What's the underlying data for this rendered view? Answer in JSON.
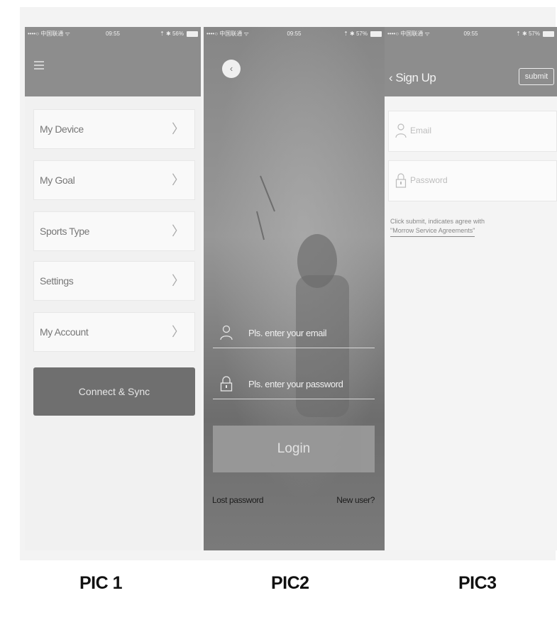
{
  "pic1": {
    "statusbar": {
      "left": "••••○ 中国联通 ᯤ",
      "time": "09:55",
      "right": "⇡ ✱ 56%"
    },
    "menu_items": [
      {
        "label": "My Device"
      },
      {
        "label": "My Goal"
      },
      {
        "label": "Sports Type"
      },
      {
        "label": "Settings"
      },
      {
        "label": "My Account"
      }
    ],
    "sync_button": "Connect & Sync"
  },
  "pic2": {
    "statusbar": {
      "left": "••••○ 中国联通 ᯤ",
      "time": "09:55",
      "right": "⇡ ✱ 57%"
    },
    "email_placeholder": "Pls. enter your email",
    "password_placeholder": "Pls. enter your password",
    "login_button": "Login",
    "forgot_link": "Lost password",
    "new_user_link": "New user?"
  },
  "pic3": {
    "statusbar": {
      "left": "••••○ 中国联通 ᯤ",
      "time": "09:55",
      "right": "⇡ ✱ 57%"
    },
    "title": "Sign Up",
    "submit_button": "submit",
    "email_placeholder": "Email",
    "password_placeholder": "Password",
    "agree_line1": "Click submit, indicates agree with",
    "agree_link": "\"Morrow Service Agreements\""
  },
  "captions": [
    "PIC 1",
    "PIC2",
    "PIC3"
  ],
  "colors": {
    "header": "#8d8d8d",
    "button_dark": "#6f6f6f",
    "photo_bg": "#8a8a8a"
  }
}
